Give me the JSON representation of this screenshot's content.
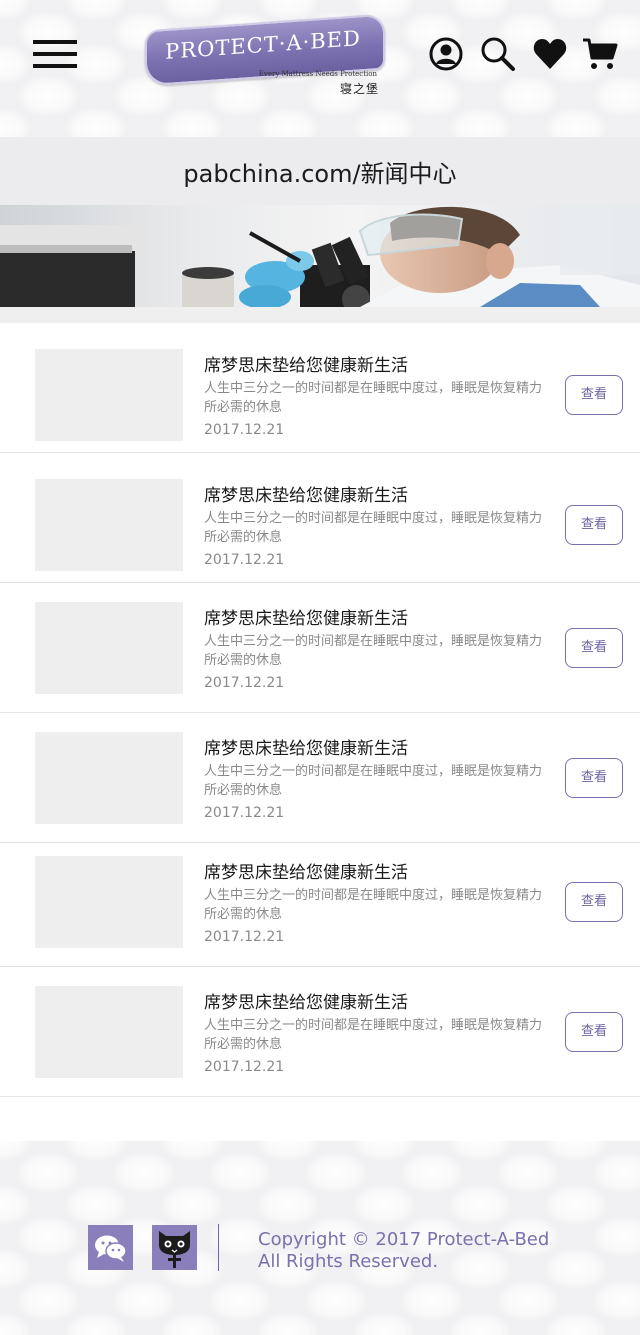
{
  "header": {
    "logo_text": "PROTECT·A·BED",
    "logo_tagline": "Every Mattress Needs Protection",
    "logo_cn": "寝之堡",
    "icons": [
      "menu-icon",
      "user-icon",
      "search-icon",
      "heart-icon",
      "cart-icon"
    ]
  },
  "page_title": "pabchina.com/新闻中心",
  "news": [
    {
      "title": "席梦思床垫给您健康新生活",
      "desc": "人生中三分之一的时间都是在睡眠中度过，睡眠是恢复精力所必需的休息",
      "date": "2017.12.21",
      "button": "查看"
    },
    {
      "title": "席梦思床垫给您健康新生活",
      "desc": "人生中三分之一的时间都是在睡眠中度过，睡眠是恢复精力所必需的休息",
      "date": "2017.12.21",
      "button": "查看"
    },
    {
      "title": "席梦思床垫给您健康新生活",
      "desc": "人生中三分之一的时间都是在睡眠中度过，睡眠是恢复精力所必需的休息",
      "date": "2017.12.21",
      "button": "查看"
    },
    {
      "title": "席梦思床垫给您健康新生活",
      "desc": "人生中三分之一的时间都是在睡眠中度过，睡眠是恢复精力所必需的休息",
      "date": "2017.12.21",
      "button": "查看"
    },
    {
      "title": "席梦思床垫给您健康新生活",
      "desc": "人生中三分之一的时间都是在睡眠中度过，睡眠是恢复精力所必需的休息",
      "date": "2017.12.21",
      "button": "查看"
    },
    {
      "title": "席梦思床垫给您健康新生活",
      "desc": "人生中三分之一的时间都是在睡眠中度过，睡眠是恢复精力所必需的休息",
      "date": "2017.12.21",
      "button": "查看"
    }
  ],
  "footer": {
    "social_icons": [
      "wechat-icon",
      "tmall-icon"
    ],
    "copyright_line1": "Copyright  © 2017 Protect-A-Bed",
    "copyright_line2": "All Rights Reserved."
  },
  "colors": {
    "brand_purple": "#7a70ad",
    "text_dark": "#1a1a1a",
    "text_muted": "#8a8a8a"
  }
}
